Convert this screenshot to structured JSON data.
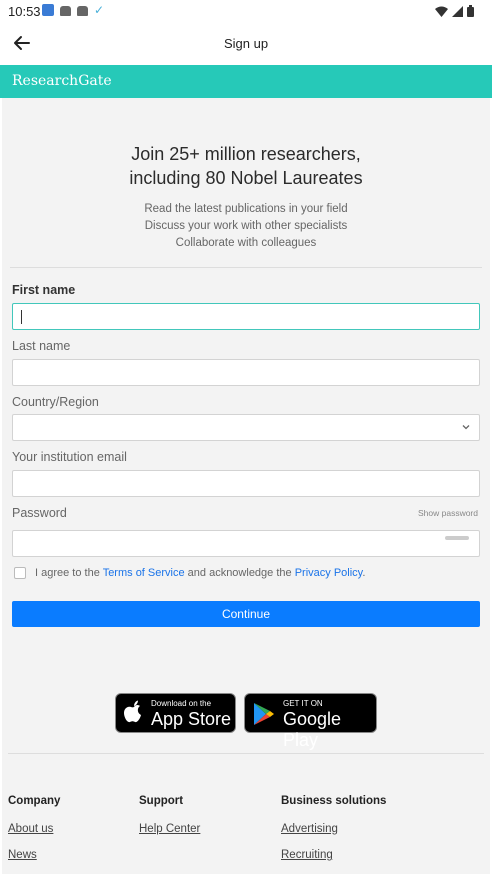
{
  "status_bar": {
    "time": "10:53"
  },
  "app_bar": {
    "title": "Sign up"
  },
  "brand": {
    "name": "ResearchGate",
    "color": "#26c9b8"
  },
  "hero": {
    "headline_line1": "Join 25+ million researchers,",
    "headline_line2": "including 80 Nobel Laureates",
    "points": [
      "Read the latest publications in your field",
      "Discuss your work with other specialists",
      "Collaborate with colleagues"
    ]
  },
  "form": {
    "first_name": {
      "label": "First name",
      "value": ""
    },
    "last_name": {
      "label": "Last name",
      "value": ""
    },
    "country": {
      "label": "Country/Region",
      "value": ""
    },
    "email": {
      "label": "Your institution email",
      "value": ""
    },
    "password": {
      "label": "Password",
      "show_label": "Show password",
      "value": ""
    },
    "agree": {
      "prefix": "I agree to the ",
      "terms": "Terms of Service",
      "middle": " and acknowledge the ",
      "privacy": "Privacy Policy",
      "suffix": ".",
      "checked": false
    },
    "continue_label": "Continue",
    "button_color": "#0a7cff"
  },
  "stores": {
    "apple": {
      "small": "Download on the",
      "big": "App Store"
    },
    "google": {
      "small": "GET IT ON",
      "big": "Google Play"
    }
  },
  "footer": {
    "company": {
      "title": "Company",
      "links": [
        "About us",
        "News"
      ]
    },
    "support": {
      "title": "Support",
      "links": [
        "Help Center"
      ]
    },
    "business": {
      "title": "Business solutions",
      "links": [
        "Advertising",
        "Recruiting"
      ]
    }
  }
}
